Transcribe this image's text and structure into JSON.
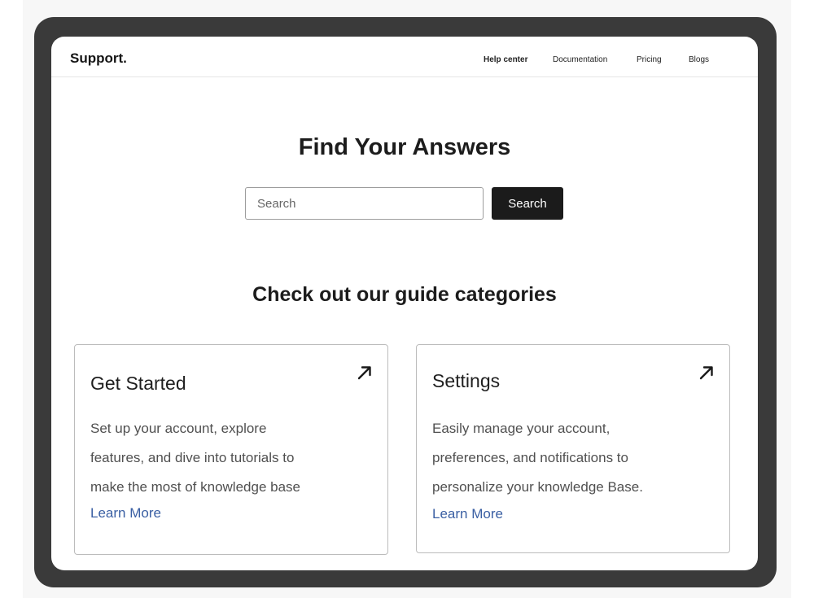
{
  "brand": "Support.",
  "nav": {
    "items": [
      {
        "label": "Help center",
        "active": true
      },
      {
        "label": "Documentation",
        "active": false
      },
      {
        "label": "Pricing",
        "active": false
      },
      {
        "label": "Blogs",
        "active": false
      }
    ]
  },
  "hero": {
    "title": "Find Your Answers",
    "search_placeholder": "Search",
    "search_value": "",
    "search_button_label": "Search"
  },
  "guides": {
    "title": "Check out our guide categories",
    "cards": [
      {
        "title": "Get Started",
        "lines": [
          "Set up your account, explore",
          "features, and dive into tutorials to",
          "make the most of knowledge base"
        ],
        "link": "Learn More",
        "icon": "arrow-up-right-icon"
      },
      {
        "title": "Settings",
        "lines": [
          "Easily manage your account,",
          "preferences, and notifications to",
          "personalize your knowledge Base."
        ],
        "link": "Learn More",
        "icon": "arrow-up-right-icon"
      }
    ]
  },
  "colors": {
    "frame": "#3a3a3a",
    "button": "#1b1b1b",
    "link": "#3a5fa3"
  }
}
